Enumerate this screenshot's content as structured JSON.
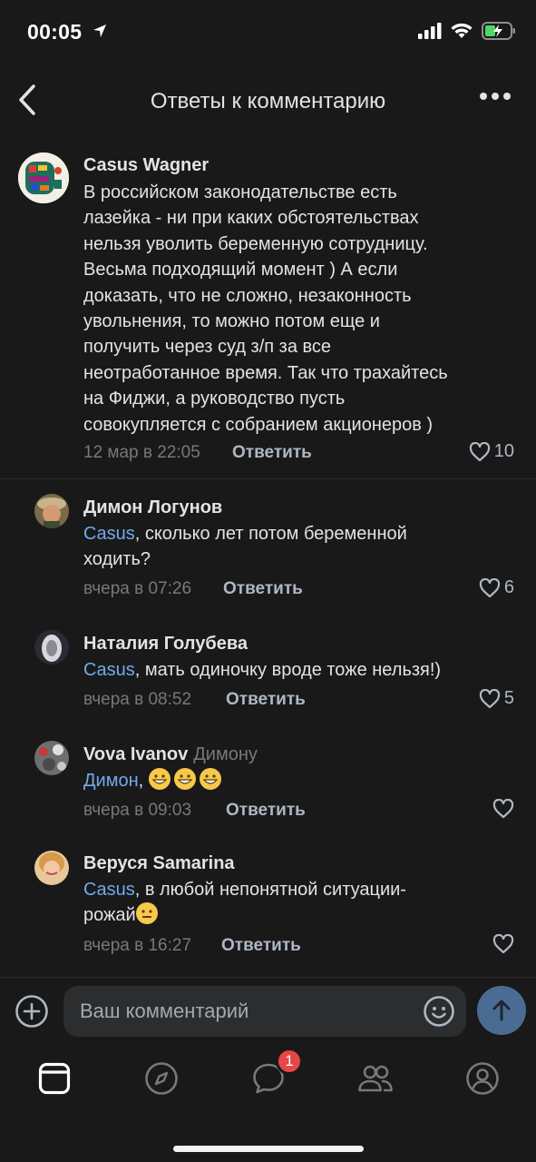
{
  "status_bar": {
    "time": "00:05"
  },
  "header": {
    "title": "Ответы к комментарию"
  },
  "root_comment": {
    "author": "Casus Wagner",
    "text_lines": [
      "В российском законодательстве есть",
      "лазейка - ни при каких обстоятельствах",
      "нельзя уволить беременную сотрудницу.",
      "Весьма подходящий момент ) А если",
      "доказать, что не сложно, незаконность",
      "увольнения, то можно потом еще и",
      "получить через суд з/п за все",
      "неотработанное время. Так что трахайтесь",
      "на Фиджи, а руководство пусть",
      "совокупляется с собранием акционеров )"
    ],
    "time": "12 мар в 22:05",
    "reply_label": "Ответить",
    "likes": "10"
  },
  "replies": [
    {
      "author": "Димон Логунов",
      "reply_to": "",
      "mention": "Casus",
      "text_line1": ", сколько лет потом беременной",
      "text_line2": "ходить?",
      "time": "вчера в 07:26",
      "reply_label": "Ответить",
      "likes": "6"
    },
    {
      "author": "Наталия Голубева",
      "reply_to": "",
      "mention": "Casus",
      "text_line1": ", мать одиночку вроде тоже нельзя!)",
      "time": "вчера в 08:52",
      "reply_label": "Ответить",
      "likes": "5"
    },
    {
      "author": "Vova Ivanov",
      "reply_to": "Димону",
      "mention": "Димон",
      "text_line1": ",",
      "emoji": "grinning-face-emoji x3",
      "time": "вчера в 09:03",
      "reply_label": "Ответить",
      "likes": ""
    },
    {
      "author": "Веруся Samarina",
      "reply_to": "",
      "mention": "Casus",
      "text_line1": ", в любой непонятной ситуации-",
      "text_line2": "рожай",
      "emoji": "neutral-face-emoji",
      "time": "вчера в 16:27",
      "reply_label": "Ответить",
      "likes": ""
    }
  ],
  "composer": {
    "placeholder": "Ваш комментарий"
  },
  "tabbar": {
    "tabs": [
      "home-icon",
      "compass-icon",
      "messages-icon",
      "friends-icon",
      "profile-icon"
    ],
    "messages_badge": "1"
  },
  "colors": {
    "background": "#19191a",
    "mention": "#71aaeb",
    "muted": "#76787a",
    "badge": "#e64646",
    "send": "#4a6c93"
  }
}
